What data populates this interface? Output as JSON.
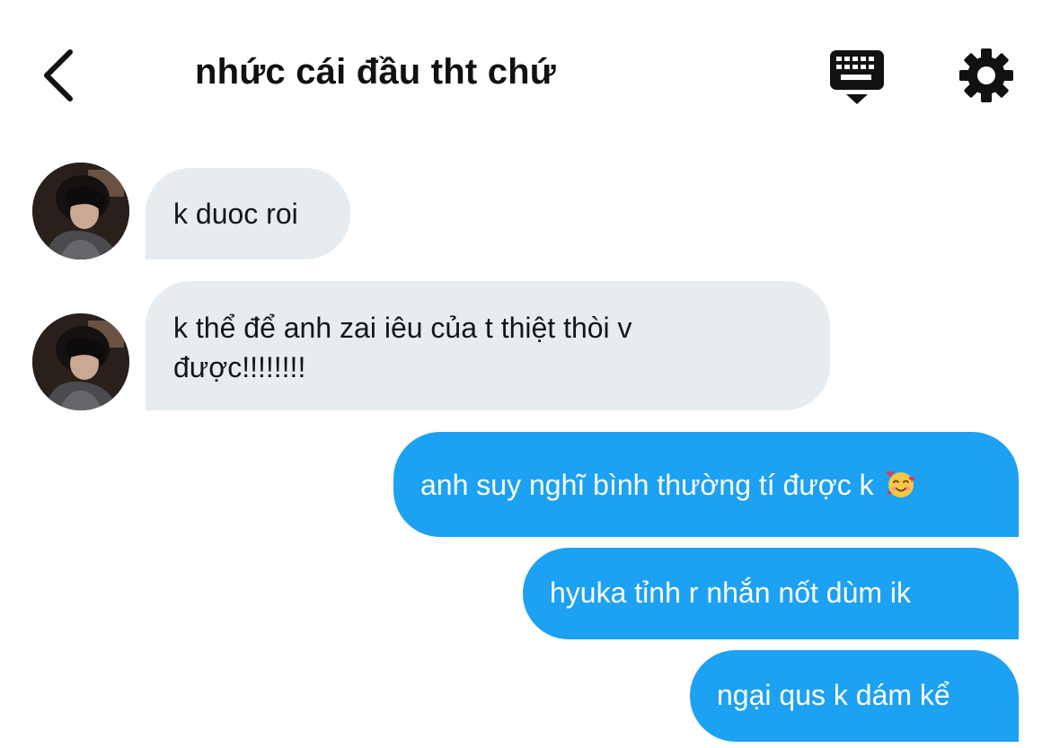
{
  "header": {
    "title": "nhức cái đầu tht chứ"
  },
  "messages": {
    "m1": {
      "text": "k duoc roi"
    },
    "m2": {
      "line1": "k thể để anh zai iêu của t thiệt thòi v",
      "line2": "được!!!!!!!!"
    },
    "m3": {
      "text": "anh suy nghĩ bình thường tí được k"
    },
    "m4": {
      "text": "hyuka tỉnh r nhắn nốt dùm ik"
    },
    "m5": {
      "text": "ngại qus k dám kể"
    }
  },
  "icons": {
    "back": "chevron-left-icon",
    "keyboard": "keyboard-icon",
    "settings": "gear-icon",
    "emoji": "smiling-face-with-hearts-emoji"
  },
  "colors": {
    "incoming_bubble": "#e6ecf0",
    "outgoing_bubble": "#1da1f2",
    "outgoing_text": "#ffffff",
    "incoming_text": "#14171a"
  }
}
